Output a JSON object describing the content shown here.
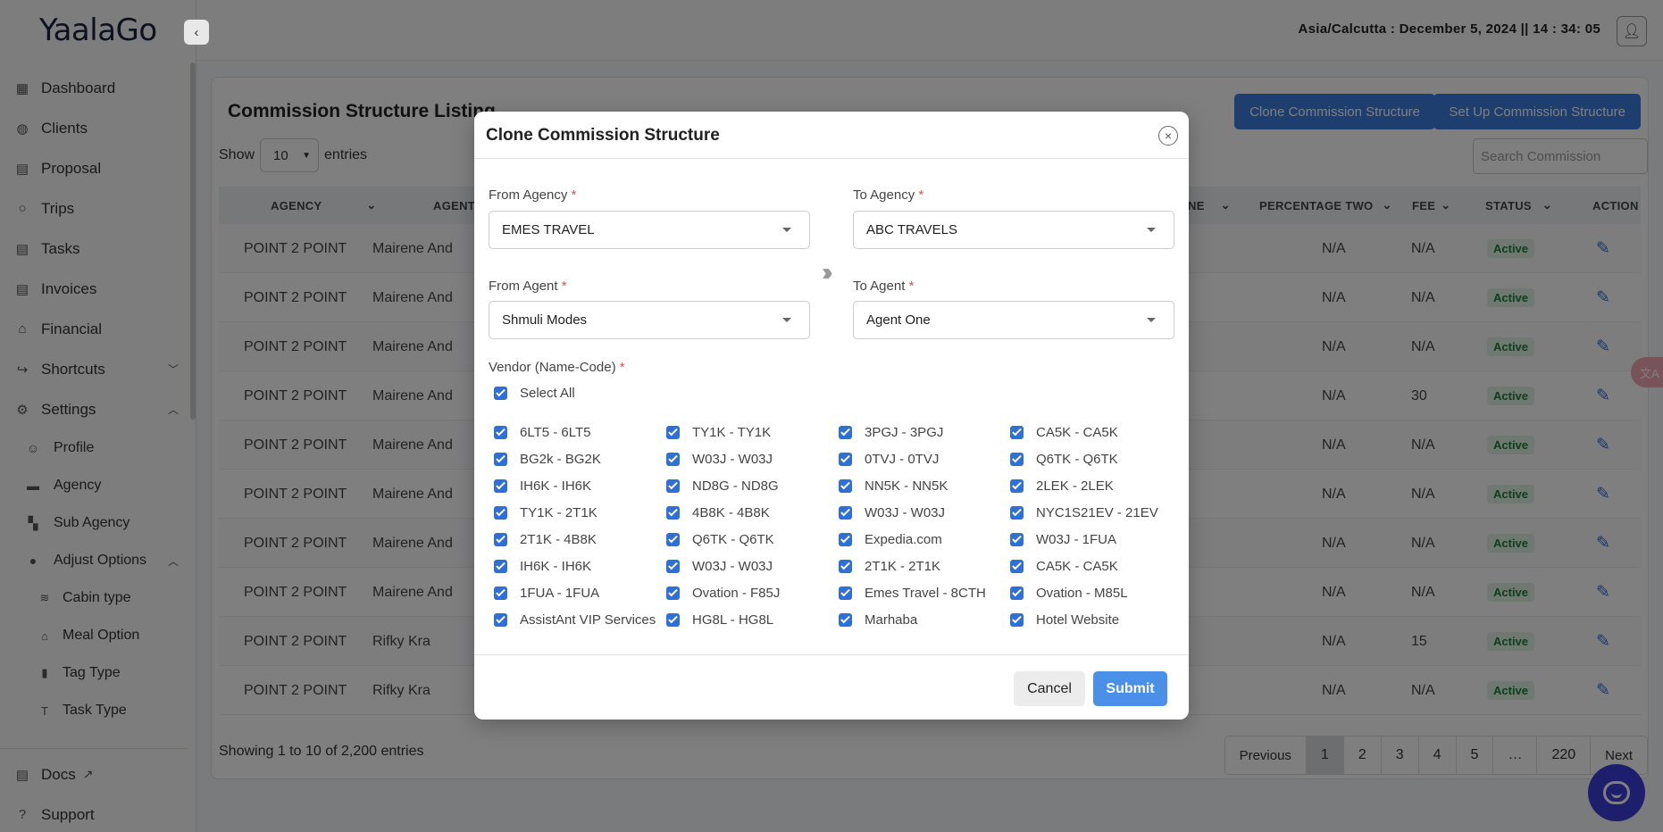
{
  "app": {
    "logo": "YaalaGo",
    "clock": "Asia/Calcutta : December 5, 2024 || 14 : 34: 05"
  },
  "sidebar": {
    "items": [
      {
        "label": "Dashboard",
        "icon": "dashboard-icon"
      },
      {
        "label": "Clients",
        "icon": "globe-icon"
      },
      {
        "label": "Proposal",
        "icon": "document-icon"
      },
      {
        "label": "Trips",
        "icon": "circle-icon"
      },
      {
        "label": "Tasks",
        "icon": "document-icon"
      },
      {
        "label": "Invoices",
        "icon": "invoice-icon"
      },
      {
        "label": "Financial",
        "icon": "bank-icon"
      },
      {
        "label": "Shortcuts",
        "icon": "share-icon"
      },
      {
        "label": "Settings",
        "icon": "gear-icon"
      }
    ],
    "settings_sub": [
      {
        "label": "Profile"
      },
      {
        "label": "Agency"
      },
      {
        "label": "Sub Agency"
      },
      {
        "label": "Adjust Options"
      }
    ],
    "adjust_sub": [
      {
        "label": "Cabin type"
      },
      {
        "label": "Meal Option"
      },
      {
        "label": "Tag Type"
      },
      {
        "label": "Task Type"
      }
    ],
    "bottom": [
      {
        "label": "Docs"
      },
      {
        "label": "Support"
      }
    ]
  },
  "listing": {
    "title": "Commission Structure Listing",
    "clone_btn": "Clone Commission Structure",
    "setup_btn": "Set Up Commission Structure",
    "show_label": "Show",
    "entries_label": "entries",
    "page_size": "10",
    "search_placeholder": "Search Commission",
    "columns": {
      "agency": "AGENCY",
      "agent": "AGENT",
      "partial": "NE",
      "pct_two": "PERCENTAGE TWO",
      "fee": "FEE",
      "status": "STATUS",
      "action": "ACTION"
    },
    "rows": [
      {
        "agency": "POINT 2 POINT",
        "agent": "Mairene And",
        "pct_two": "N/A",
        "fee": "N/A",
        "status": "Active"
      },
      {
        "agency": "POINT 2 POINT",
        "agent": "Mairene And",
        "pct_two": "N/A",
        "fee": "N/A",
        "status": "Active"
      },
      {
        "agency": "POINT 2 POINT",
        "agent": "Mairene And",
        "pct_two": "N/A",
        "fee": "N/A",
        "status": "Active"
      },
      {
        "agency": "POINT 2 POINT",
        "agent": "Mairene And",
        "pct_two": "N/A",
        "fee": "30",
        "status": "Active"
      },
      {
        "agency": "POINT 2 POINT",
        "agent": "Mairene And",
        "pct_two": "N/A",
        "fee": "N/A",
        "status": "Active"
      },
      {
        "agency": "POINT 2 POINT",
        "agent": "Mairene And",
        "pct_two": "N/A",
        "fee": "N/A",
        "status": "Active"
      },
      {
        "agency": "POINT 2 POINT",
        "agent": "Mairene And",
        "pct_two": "N/A",
        "fee": "N/A",
        "status": "Active"
      },
      {
        "agency": "POINT 2 POINT",
        "agent": "Mairene And",
        "pct_two": "N/A",
        "fee": "N/A",
        "status": "Active"
      },
      {
        "agency": "POINT 2 POINT",
        "agent": "Rifky Kra",
        "pct_two": "N/A",
        "fee": "15",
        "status": "Active"
      },
      {
        "agency": "POINT 2 POINT",
        "agent": "Rifky Kra",
        "pct_two": "N/A",
        "fee": "N/A",
        "status": "Active"
      }
    ],
    "info": "Showing 1 to 10 of 2,200 entries",
    "pager": {
      "prev": "Previous",
      "p1": "1",
      "p2": "2",
      "p3": "3",
      "p4": "4",
      "p5": "5",
      "ellipsis": "…",
      "last": "220",
      "next": "Next"
    }
  },
  "modal": {
    "title": "Clone Commission Structure",
    "from_agency_label": "From Agency",
    "from_agency": "EMES TRAVEL",
    "to_agency_label": "To Agency",
    "to_agency": "ABC TRAVELS",
    "from_agent_label": "From Agent",
    "from_agent": "Shmuli Modes",
    "to_agent_label": "To Agent",
    "to_agent": "Agent One",
    "required_mark": "*",
    "vendor_label": "Vendor (Name-Code)",
    "select_all": "Select All",
    "vendors": [
      [
        "6LT5 - 6LT5",
        "TY1K - TY1K",
        "3PGJ - 3PGJ",
        "CA5K - CA5K"
      ],
      [
        "BG2k - BG2K",
        "W03J - W03J",
        "0TVJ - 0TVJ",
        "Q6TK - Q6TK"
      ],
      [
        "IH6K - IH6K",
        "ND8G - ND8G",
        "NN5K - NN5K",
        "2LEK - 2LEK"
      ],
      [
        "TY1K - 2T1K",
        "4B8K - 4B8K",
        "W03J - W03J",
        "NYC1S21EV - 21EV"
      ],
      [
        "2T1K - 4B8K",
        "Q6TK - Q6TK",
        "Expedia.com",
        "W03J - 1FUA"
      ],
      [
        "IH6K - IH6K",
        "W03J - W03J",
        "2T1K - 2T1K",
        "CA5K - CA5K"
      ],
      [
        "1FUA - 1FUA",
        "Ovation - F85J",
        "Emes Travel - 8CTH",
        "Ovation - M85L"
      ],
      [
        "AssistAnt VIP Services",
        "HG8L - HG8L",
        "Marhaba",
        "Hotel Website"
      ]
    ],
    "cancel": "Cancel",
    "submit": "Submit"
  }
}
